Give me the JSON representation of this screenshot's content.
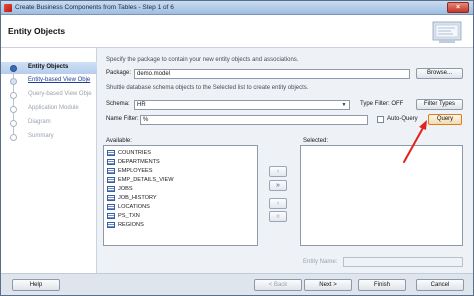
{
  "window": {
    "title": "Create Business Components from Tables - Step 1 of 6"
  },
  "header": {
    "title": "Entity Objects"
  },
  "nav": {
    "items": [
      {
        "label": "Entity Objects",
        "state": "current"
      },
      {
        "label": "Entity-based View Obje",
        "state": "link"
      },
      {
        "label": "Query-based View Obje",
        "state": "disabled"
      },
      {
        "label": "Application Module",
        "state": "disabled"
      },
      {
        "label": "Diagram",
        "state": "disabled"
      },
      {
        "label": "Summary",
        "state": "disabled"
      }
    ]
  },
  "content": {
    "package_desc": "Specify the package to contain your new entity objects and associations.",
    "package_label": "Package:",
    "package_value": "demo.model",
    "browse_label": "Browse...",
    "shuttle_desc": "Shuttle database schema objects to the Selected list to create entity objects.",
    "schema_label": "Schema:",
    "schema_value": "HR",
    "type_filter_label": "Type Filter: OFF",
    "filter_types_label": "Filter Types",
    "name_filter_label": "Name Filter:",
    "name_filter_value": "%",
    "auto_query_label": "Auto-Query",
    "query_label": "Query",
    "available_label": "Available:",
    "selected_label": "Selected:",
    "available_items": [
      "COUNTRIES",
      "DEPARTMENTS",
      "EMPLOYEES",
      "EMP_DETAILS_VIEW",
      "JOBS",
      "JOB_HISTORY",
      "LOCATIONS",
      "PS_TXN",
      "REGIONS"
    ],
    "shuttle_buttons": [
      {
        "glyph": "›",
        "state": "inactive"
      },
      {
        "glyph": "»",
        "state": "active"
      },
      {
        "glyph": "‹",
        "state": "inactive"
      },
      {
        "glyph": "«",
        "state": "inactive"
      }
    ],
    "entity_name_label": "Entity Name:"
  },
  "footer": {
    "help_label": "Help",
    "back_label": "< Back",
    "next_label": "Next >",
    "finish_label": "Finish",
    "cancel_label": "Cancel"
  },
  "colors": {
    "accent": "#2462c7",
    "annotation": "#e0231c",
    "highlight": "#e07a1a"
  },
  "icons": [
    "app-icon",
    "close-icon",
    "wizard-graphic-icon",
    "table-icon",
    "arrow-annotation-icon"
  ]
}
